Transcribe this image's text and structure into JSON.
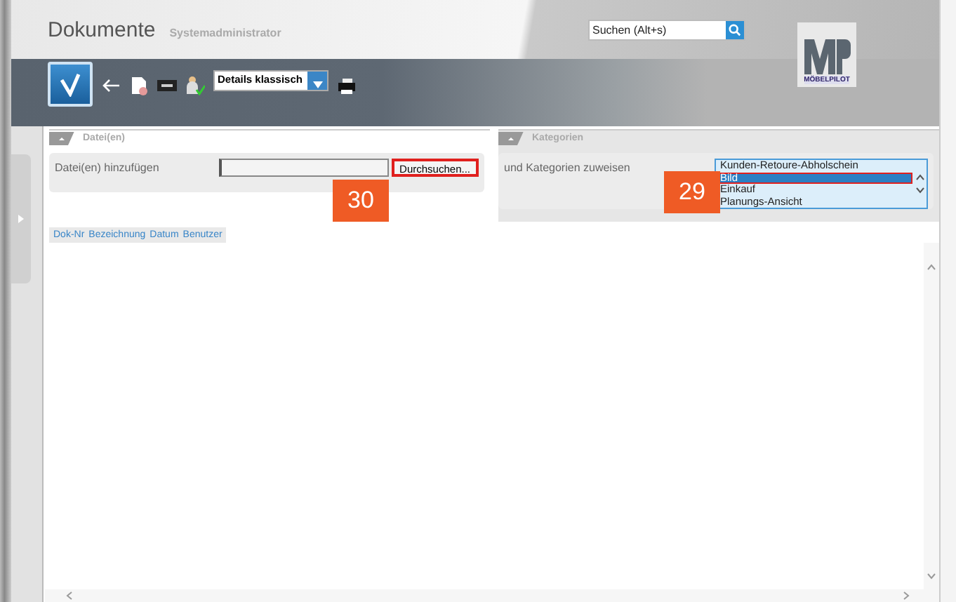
{
  "header": {
    "title": "Dokumente",
    "user": "Systemadministrator",
    "search": {
      "placeholder": "Suchen (Alt+s)"
    },
    "logo": {
      "brand": "MÖBELPILOT"
    }
  },
  "toolbar": {
    "view_select": {
      "value": "Details klassisch"
    }
  },
  "files_panel": {
    "title": "Datei(en)",
    "expanded": true,
    "label": "Datei(en) hinzufügen",
    "browse_button": {
      "label": "Durchsuchen...",
      "highlighted": true
    },
    "step_badge": "30"
  },
  "categories_panel": {
    "title": "Kategorien",
    "expanded": true,
    "label": "und Kategorien zuweisen",
    "step_badge": "29",
    "items": [
      {
        "label": "Kunden-Retoure-Abholschein",
        "selected": false,
        "highlighted": false
      },
      {
        "label": "Bild",
        "selected": true,
        "highlighted": true
      },
      {
        "label": "Einkauf",
        "selected": false,
        "highlighted": false
      },
      {
        "label": "Planungs-Ansicht",
        "selected": false,
        "highlighted": false
      }
    ]
  },
  "table": {
    "columns": [
      "Dok-Nr",
      "Bezeichnung",
      "Datum",
      "Benutzer"
    ]
  }
}
